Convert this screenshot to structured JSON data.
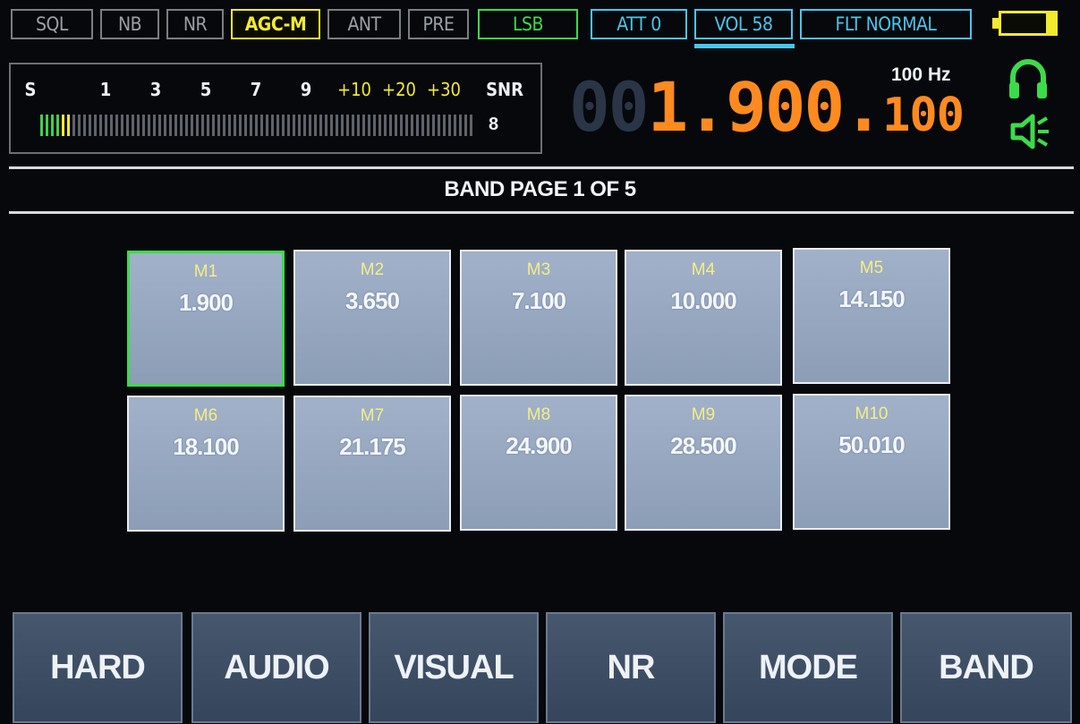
{
  "status_bar": {
    "sql": "SQL",
    "nb": "NB",
    "nr": "NR",
    "agc": "AGC-M",
    "ant": "ANT",
    "pre": "PRE",
    "mode": "LSB",
    "att": "ATT 0",
    "vol": "VOL 58",
    "filter": "FLT NORMAL"
  },
  "battery": {
    "icon": "battery-icon",
    "color": "#f2ea2e"
  },
  "smeter": {
    "scale_labels": [
      "S",
      "1",
      "3",
      "5",
      "7",
      "9",
      "+10",
      "+20",
      "+30",
      "SNR"
    ],
    "snr_value": "8",
    "level_segments_lit": 6,
    "colors": {
      "low": "#40d04e",
      "mid": "#f2ea2e",
      "off": "#5e636b"
    }
  },
  "frequency": {
    "dim_digits": "00",
    "main": "1.900.",
    "sub": "100",
    "step": "100 Hz",
    "color": "#ff8a1f"
  },
  "audio_icons": {
    "headphone": "headphone-icon",
    "speaker": "speaker-icon",
    "color": "#3bdc4a"
  },
  "page": {
    "title": "BAND PAGE 1 OF 5"
  },
  "memories": [
    {
      "name": "M1",
      "freq": "1.900",
      "selected": true
    },
    {
      "name": "M2",
      "freq": "3.650"
    },
    {
      "name": "M3",
      "freq": "7.100"
    },
    {
      "name": "M4",
      "freq": "10.000"
    },
    {
      "name": "M5",
      "freq": "14.150"
    },
    {
      "name": "M6",
      "freq": "18.100"
    },
    {
      "name": "M7",
      "freq": "21.175"
    },
    {
      "name": "M8",
      "freq": "24.900"
    },
    {
      "name": "M9",
      "freq": "28.500"
    },
    {
      "name": "M10",
      "freq": "50.010"
    }
  ],
  "function_buttons": [
    "HARD",
    "AUDIO",
    "VISUAL",
    "NR",
    "MODE",
    "BAND"
  ]
}
